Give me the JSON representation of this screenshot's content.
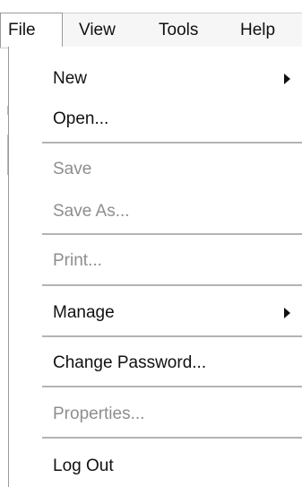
{
  "menubar": {
    "items": [
      {
        "label": "File"
      },
      {
        "label": "View"
      },
      {
        "label": "Tools"
      },
      {
        "label": "Help"
      }
    ]
  },
  "file_menu": {
    "items": [
      {
        "label": "New",
        "enabled": true,
        "has_submenu": true
      },
      {
        "label": "Open...",
        "enabled": true,
        "has_submenu": false
      },
      {
        "label": "Save",
        "enabled": false,
        "has_submenu": false
      },
      {
        "label": "Save As...",
        "enabled": false,
        "has_submenu": false
      },
      {
        "label": "Print...",
        "enabled": false,
        "has_submenu": false
      },
      {
        "label": "Manage",
        "enabled": true,
        "has_submenu": true
      },
      {
        "label": "Change Password...",
        "enabled": true,
        "has_submenu": false
      },
      {
        "label": "Properties...",
        "enabled": false,
        "has_submenu": false
      },
      {
        "label": "Log Out",
        "enabled": true,
        "has_submenu": false
      }
    ]
  }
}
